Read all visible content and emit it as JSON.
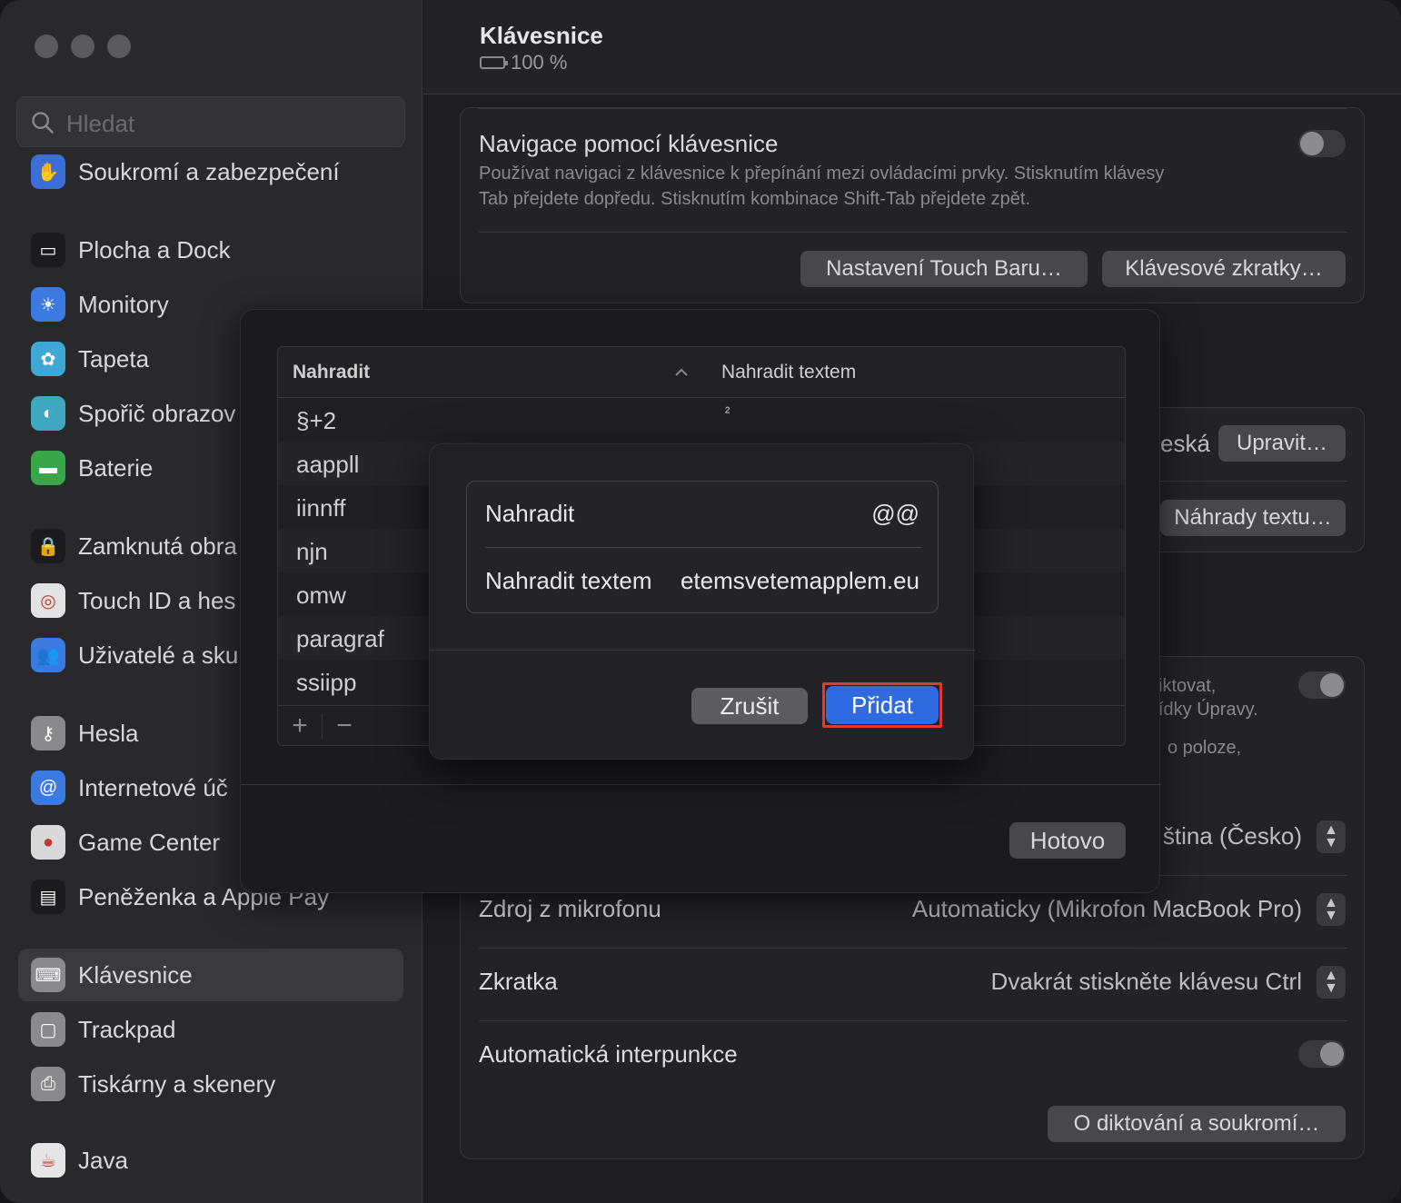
{
  "sidebar": {
    "search_placeholder": "Hledat",
    "items": [
      {
        "label": "Soukromí a zabezpečení",
        "icon": "hand-icon",
        "color": "#3b6fd6"
      },
      {
        "label": "Plocha a Dock",
        "icon": "dock-icon",
        "color": "#1b1b1d"
      },
      {
        "label": "Monitory",
        "icon": "sun-icon",
        "color": "#3b7ae0"
      },
      {
        "label": "Tapeta",
        "icon": "flower-icon",
        "color": "#3fa7d6"
      },
      {
        "label": "Spořič obrazov",
        "icon": "screensaver-icon",
        "color": "#3fa7c0"
      },
      {
        "label": "Baterie",
        "icon": "battery-icon",
        "color": "#3aa64a"
      },
      {
        "label": "Zamknutá obra",
        "icon": "lock-icon",
        "color": "#1b1b1d"
      },
      {
        "label": "Touch ID a hes",
        "icon": "fingerprint-icon",
        "color": "#e3e3e3"
      },
      {
        "label": "Uživatelé a sku",
        "icon": "users-icon",
        "color": "#3b7ae0"
      },
      {
        "label": "Hesla",
        "icon": "key-icon",
        "color": "#8a8a8d"
      },
      {
        "label": "Internetové úč",
        "icon": "at-icon",
        "color": "#3b7ae0"
      },
      {
        "label": "Game Center",
        "icon": "gamecenter-icon",
        "color": "#d9d9d9"
      },
      {
        "label": "Peněženka a Apple Pay",
        "icon": "wallet-icon",
        "color": "#1b1b1d"
      },
      {
        "label": "Klávesnice",
        "icon": "keyboard-icon",
        "color": "#8a8a8d"
      },
      {
        "label": "Trackpad",
        "icon": "trackpad-icon",
        "color": "#8a8a8d"
      },
      {
        "label": "Tiskárny a skenery",
        "icon": "printer-icon",
        "color": "#8a8a8d"
      },
      {
        "label": "Java",
        "icon": "java-icon",
        "color": "#e6e6e6"
      }
    ]
  },
  "main": {
    "title": "Klávesnice",
    "battery": "100 %",
    "keyboard_nav": {
      "title": "Navigace pomocí klávesnice",
      "desc_line1": "Používat navigaci z klávesnice k přepínání mezi ovládacími prvky. Stisknutím klávesy",
      "desc_line2": "Tab přejdete dopředu. Stisknutím kombinace Shift-Tab přejdete zpět.",
      "toggle_on": false
    },
    "touchbar_button": "Nastavení Touch Baru…",
    "shortcuts_button": "Klávesové zkratky…",
    "input_partial": "eská",
    "edit_button": "Upravit…",
    "replacements_button": "Náhrady textu…",
    "dictation_partial1": "iktovat,",
    "dictation_partial2": "ídky Úpravy.",
    "dictation_partial3": "o poloze,",
    "language_value": "ština (Česko)",
    "mic_label": "Zdroj z mikrofonu",
    "mic_value": "Automaticky (Mikrofon MacBook Pro)",
    "shortcut_label": "Zkratka",
    "shortcut_value": "Dvakrát stiskněte klávesu Ctrl",
    "punct_label": "Automatická interpunkce",
    "privacy_button": "O diktování a soukromí…"
  },
  "sheet": {
    "col1": "Nahradit",
    "col2": "Nahradit textem",
    "rows": [
      {
        "replace": "§+2",
        "with": "²"
      },
      {
        "replace": "aappll",
        "with": ""
      },
      {
        "replace": "iinnff",
        "with": ""
      },
      {
        "replace": "njn",
        "with": ""
      },
      {
        "replace": "omw",
        "with": ""
      },
      {
        "replace": "paragraf",
        "with": ""
      },
      {
        "replace": "ssiipp",
        "with": ""
      }
    ],
    "add_symbol": "+",
    "remove_symbol": "−",
    "done_button": "Hotovo"
  },
  "dialog": {
    "replace_label": "Nahradit",
    "replace_value": "@@",
    "with_label": "Nahradit textem",
    "with_value": "etemsvetemapplem.eu",
    "cancel_button": "Zrušit",
    "add_button": "Přidat",
    "highlight_color": "#e03a2f",
    "accent_color": "#2f6be0"
  }
}
